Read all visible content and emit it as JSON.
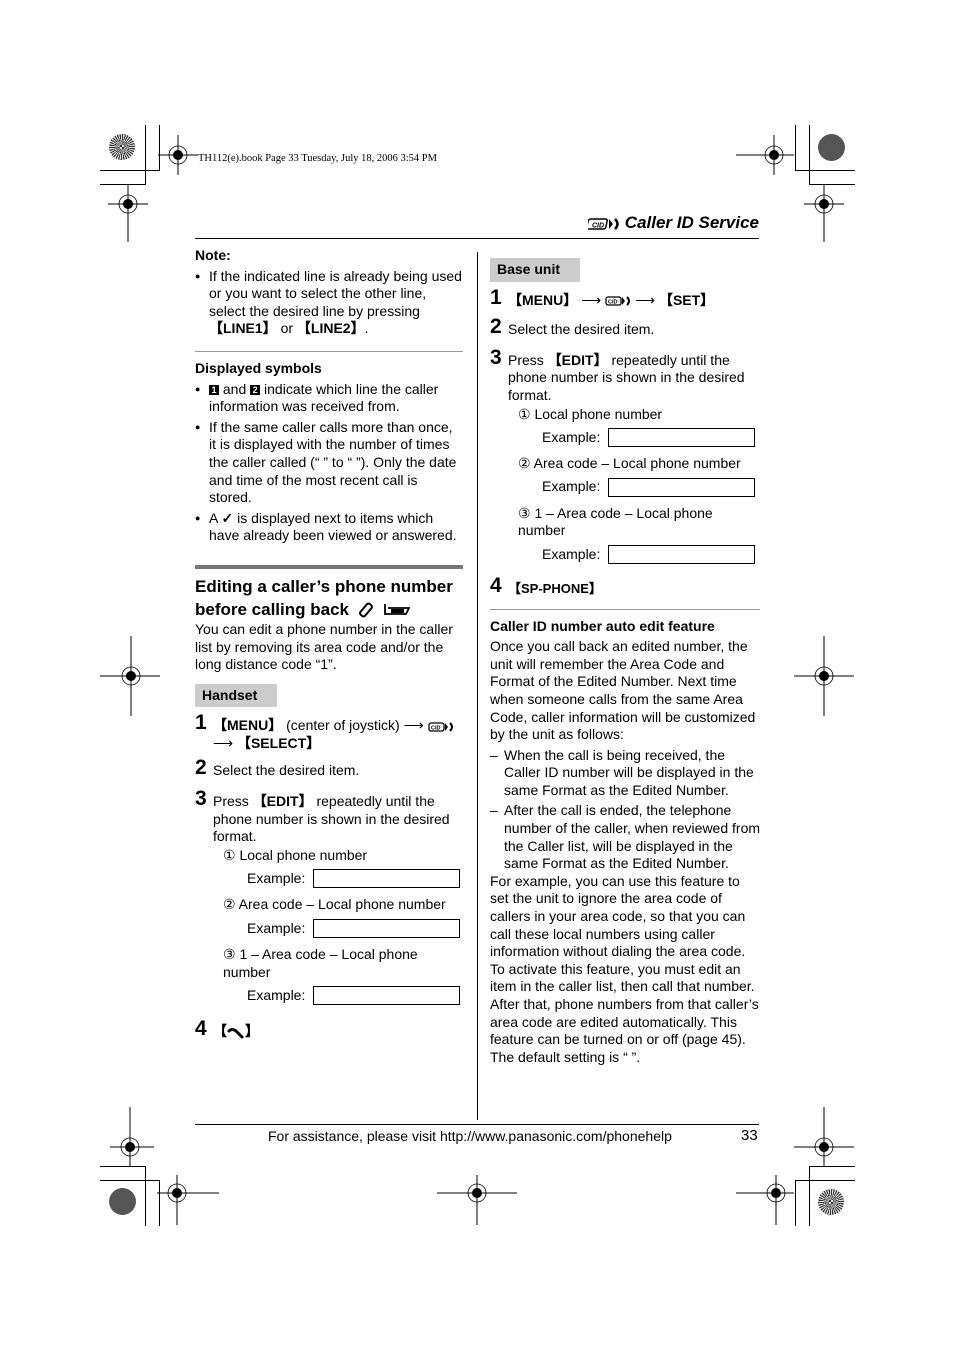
{
  "book_info": "TH112(e).book  Page 33  Tuesday, July 18, 2006  3:54 PM",
  "header": {
    "icon": "caller-id-icon",
    "title": "Caller ID Service"
  },
  "left": {
    "note_heading": "Note:",
    "note_bullet": [
      "If the indicated line is already being used or you want to select the other line, select the desired line by pressing ",
      "【LINE1】",
      " or ",
      "【LINE2】",
      "."
    ],
    "displayed_heading": "Displayed symbols",
    "sym1": "1",
    "sym2": "2",
    "disp_b1_a": " and ",
    "disp_b1_b": " indicate which line the caller information was received from.",
    "disp_b2": "If the same caller calls more than once, it is displayed with the number of times the caller called (“    ” to “    ”). Only the date and time of the most recent call is stored.",
    "disp_b3_a": "A ",
    "disp_b3_check": "✓",
    "disp_b3_b": " is displayed next to items which have already been viewed or answered.",
    "section_title": "Editing a caller’s phone number before calling back",
    "section_intro": "You can edit a phone number in the caller list by removing its area code and/or the long distance code “1”.",
    "tag": "Handset",
    "steps": {
      "s1_num": "1",
      "s1_menu": "【MENU】",
      "s1_text": " (center of joystick) ",
      "arrow": "⟶",
      "s1_select": "【SELECT】",
      "s2_num": "2",
      "s2_text": "Select the desired item.",
      "s3_num": "3",
      "s3_a": "Press ",
      "s3_key": "【EDIT】",
      "s3_b": " repeatedly until the phone number is shown in the desired format.",
      "opt1": "① Local phone number",
      "opt2": "② Area code – Local phone number",
      "opt3": "③ 1 – Area code – Local phone number",
      "example": "Example:",
      "s4_num": "4",
      "s4_open": "【",
      "s4_close": "】"
    }
  },
  "right": {
    "tag": "Base unit",
    "s1_num": "1",
    "s1_menu": "【MENU】",
    "arrow": "⟶",
    "s1_set": "【SET】",
    "s2_num": "2",
    "s2_text": "Select the desired item.",
    "s3_num": "3",
    "s3_a": "Press ",
    "s3_key": "【EDIT】",
    "s3_b": " repeatedly until the phone number is shown in the desired format.",
    "opt1": "① Local phone number",
    "opt2": "② Area code – Local phone number",
    "opt3": "③ 1 – Area code – Local phone number",
    "example": "Example:",
    "s4_num": "4",
    "s4_key": "【SP-PHONE】",
    "auto_heading": "Caller ID number auto edit feature",
    "auto_intro": "Once you call back an edited number, the unit will remember the Area Code and Format of the Edited Number. Next time when someone calls from the same Area Code, caller information will be customized by the unit as follows:",
    "dash1": "When the call is being received, the Caller ID number will be displayed in the same Format as the Edited Number.",
    "dash2": "After the call is ended, the telephone number of the caller, when reviewed from the Caller list, will be displayed in the same Format as the Edited Number.",
    "auto_body": "For example, you can use this feature to set the unit to ignore the area code of callers in your area code, so that you can call these local numbers using caller information without dialing the area code. To activate this feature, you must edit an item in the caller list, then call that number. After that, phone numbers from that caller’s area code are edited automatically. This feature can be turned on or off (page 45). The default setting is “    ”."
  },
  "footer": {
    "text": "For assistance, please visit http://www.panasonic.com/phonehelp",
    "page": "33"
  }
}
